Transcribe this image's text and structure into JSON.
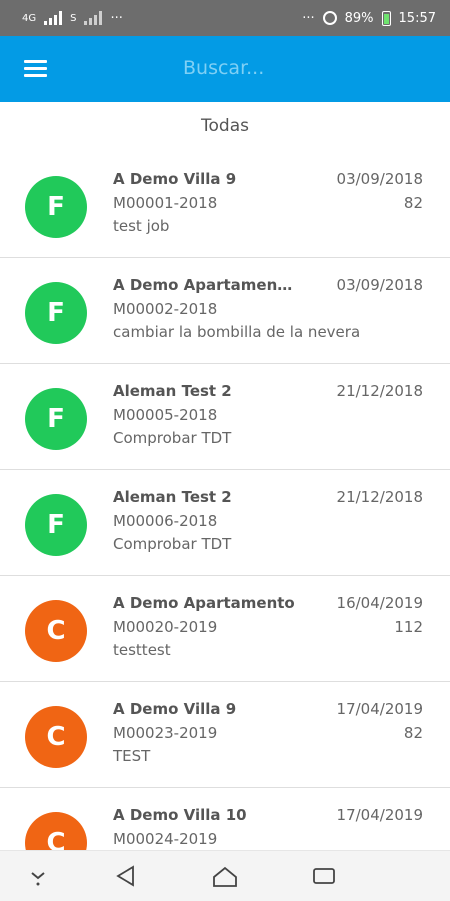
{
  "status_bar": {
    "network_label": "4G",
    "sim_label": "S",
    "overflow": "···",
    "battery_percent": "89%",
    "time": "15:57"
  },
  "app_bar": {
    "search_placeholder": "Buscar..."
  },
  "section": {
    "title": "Todas"
  },
  "items": [
    {
      "initial": "F",
      "color": "#21c95a",
      "name": "A Demo Villa 9",
      "ref": "M00001-2018",
      "desc": "test job",
      "date": "03/09/2018",
      "count": "82"
    },
    {
      "initial": "F",
      "color": "#21c95a",
      "name": "A Demo Apartament...",
      "ref": "M00002-2018",
      "desc": "cambiar la bombilla de la nevera",
      "date": "03/09/2018",
      "count": ""
    },
    {
      "initial": "F",
      "color": "#21c95a",
      "name": "Aleman Test 2",
      "ref": "M00005-2018",
      "desc": "Comprobar TDT",
      "date": "21/12/2018",
      "count": ""
    },
    {
      "initial": "F",
      "color": "#21c95a",
      "name": "Aleman Test 2",
      "ref": "M00006-2018",
      "desc": "Comprobar TDT",
      "date": "21/12/2018",
      "count": ""
    },
    {
      "initial": "C",
      "color": "#f06514",
      "name": "A Demo Apartamento",
      "ref": "M00020-2019",
      "desc": "testtest",
      "date": "16/04/2019",
      "count": "112"
    },
    {
      "initial": "C",
      "color": "#f06514",
      "name": "A Demo Villa 9",
      "ref": "M00023-2019",
      "desc": "TEST",
      "date": "17/04/2019",
      "count": "82"
    },
    {
      "initial": "C",
      "color": "#f06514",
      "name": "A Demo Villa 10",
      "ref": "M00024-2019",
      "desc": "",
      "date": "17/04/2019",
      "count": ""
    }
  ],
  "nav_bar": {
    "icons": [
      "chevron-down-icon",
      "back-icon",
      "home-icon",
      "recents-icon"
    ]
  }
}
